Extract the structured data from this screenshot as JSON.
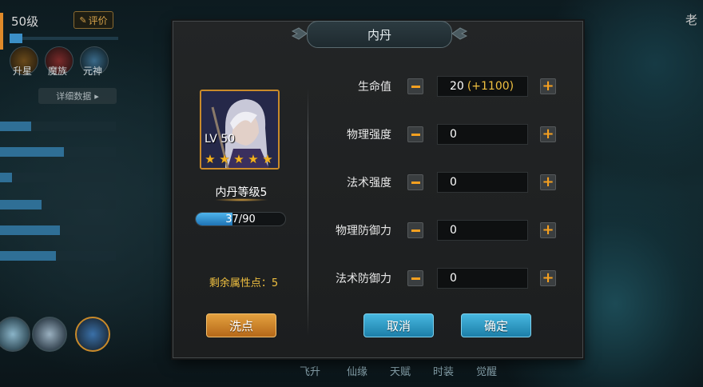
{
  "background": {
    "level": "50级",
    "eval_label": "评价",
    "features": [
      {
        "label": "升星",
        "icon": "star-upgrade-icon"
      },
      {
        "label": "魔族",
        "icon": "demon-clan-icon"
      },
      {
        "label": "元神",
        "icon": "spirit-icon"
      }
    ],
    "detail_label": "详细数据",
    "stat_bar_levels": [
      0.27,
      0.55,
      0.1,
      0.36,
      0.52,
      0.48
    ],
    "bottom_tabs": [
      "飞升",
      "仙缘",
      "天赋",
      "时装",
      "觉醒"
    ],
    "right_edge_text": "老"
  },
  "dialog": {
    "title": "内丹",
    "portrait": {
      "level_label": "LV 50",
      "stars": 5
    },
    "core_level": "内丹等级5",
    "exp": {
      "current": 37,
      "max": 90,
      "text": "37/90"
    },
    "remaining_points": "剩余属性点：5",
    "reset_label": "洗点",
    "cancel_label": "取消",
    "confirm_label": "确定",
    "attributes": [
      {
        "label": "生命值",
        "value": "20",
        "bonus": "(+1100)"
      },
      {
        "label": "物理强度",
        "value": "0",
        "bonus": ""
      },
      {
        "label": "法术强度",
        "value": "0",
        "bonus": ""
      },
      {
        "label": "物理防御力",
        "value": "0",
        "bonus": ""
      },
      {
        "label": "法术防御力",
        "value": "0",
        "bonus": ""
      }
    ]
  },
  "colors": {
    "accent_orange": "#f5a020",
    "gold_text": "#f0c040",
    "blue_button": "#2a94c4",
    "orange_button": "#d08a2e"
  }
}
